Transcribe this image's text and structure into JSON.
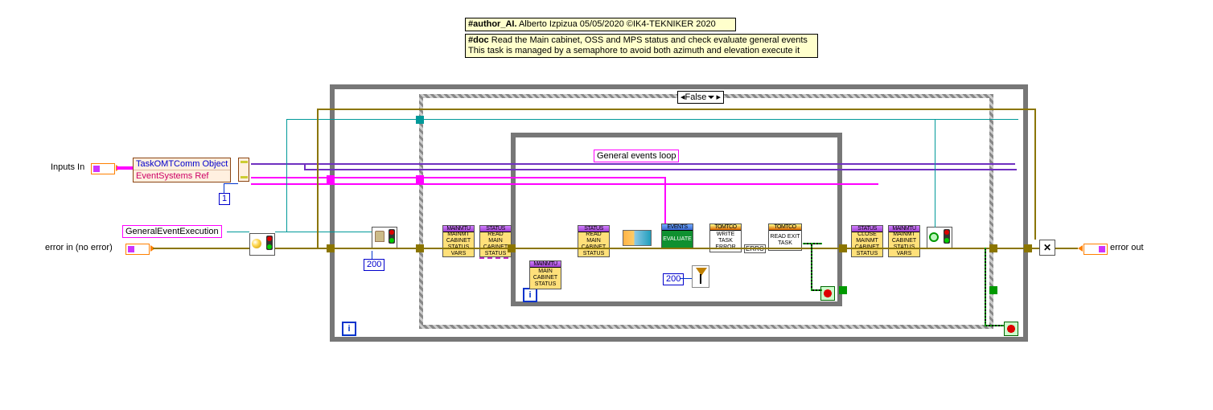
{
  "comments": {
    "author": {
      "tag": "#author_AI.",
      "text": " Alberto Izpizua 05/05/2020 ©IK4-TEKNIKER 2020"
    },
    "doc": {
      "tag": "#doc",
      "line1": " Read the Main cabinet, OSS and MPS status and check evaluate general events",
      "line2": "This task is managed by a semaphore to avoid both azimuth and elevation execute it"
    }
  },
  "terminals": {
    "inputs_in": "Inputs In",
    "error_in": "error in (no error)",
    "error_out": "error out",
    "general_event_exec": "GeneralEventExecution"
  },
  "unbundle": {
    "task_comm": "TaskOMTComm Object",
    "event_sys": "EventSystems Ref"
  },
  "constants": {
    "one": "1",
    "two_hundred_a": "200",
    "two_hundred_b": "200"
  },
  "case": {
    "selector": "False"
  },
  "inner_loop_label": "General events loop",
  "nodes": {
    "maincab_vars": {
      "hdr": "MAINMTU",
      "body": "MAINMT\nCABINET\nSTATUS\nVARS"
    },
    "status_read1": {
      "hdr": "STATUS",
      "body": "READ\nMAIN\nCABINET\nSTATUS"
    },
    "maincab_only": {
      "hdr": "MAINMTU",
      "body": "MAIN\nCABINET\nSTATUS"
    },
    "status_read2": {
      "hdr": "STATUS",
      "body": "READ\nMAIN\nCABINET\nSTATUS"
    },
    "events_eval": {
      "hdr": "EVENTS",
      "body": "EVALUATE"
    },
    "tomt_write": {
      "hdr": "TOMTCO",
      "body": "WRITE\nTASK\nERROR"
    },
    "tomt_exit": {
      "hdr": "TOMTCO",
      "body": "READ EXIT\nTASK"
    },
    "status_close": {
      "hdr": "STATUS",
      "body": "CLOSE\nMAINMT\nCABINET\nSTATUS"
    },
    "maincab_vars2": {
      "hdr": "MAINMTU",
      "body": "MAINMT\nCABINET\nSTATUS\nVARS"
    },
    "errc": "ERRC"
  }
}
